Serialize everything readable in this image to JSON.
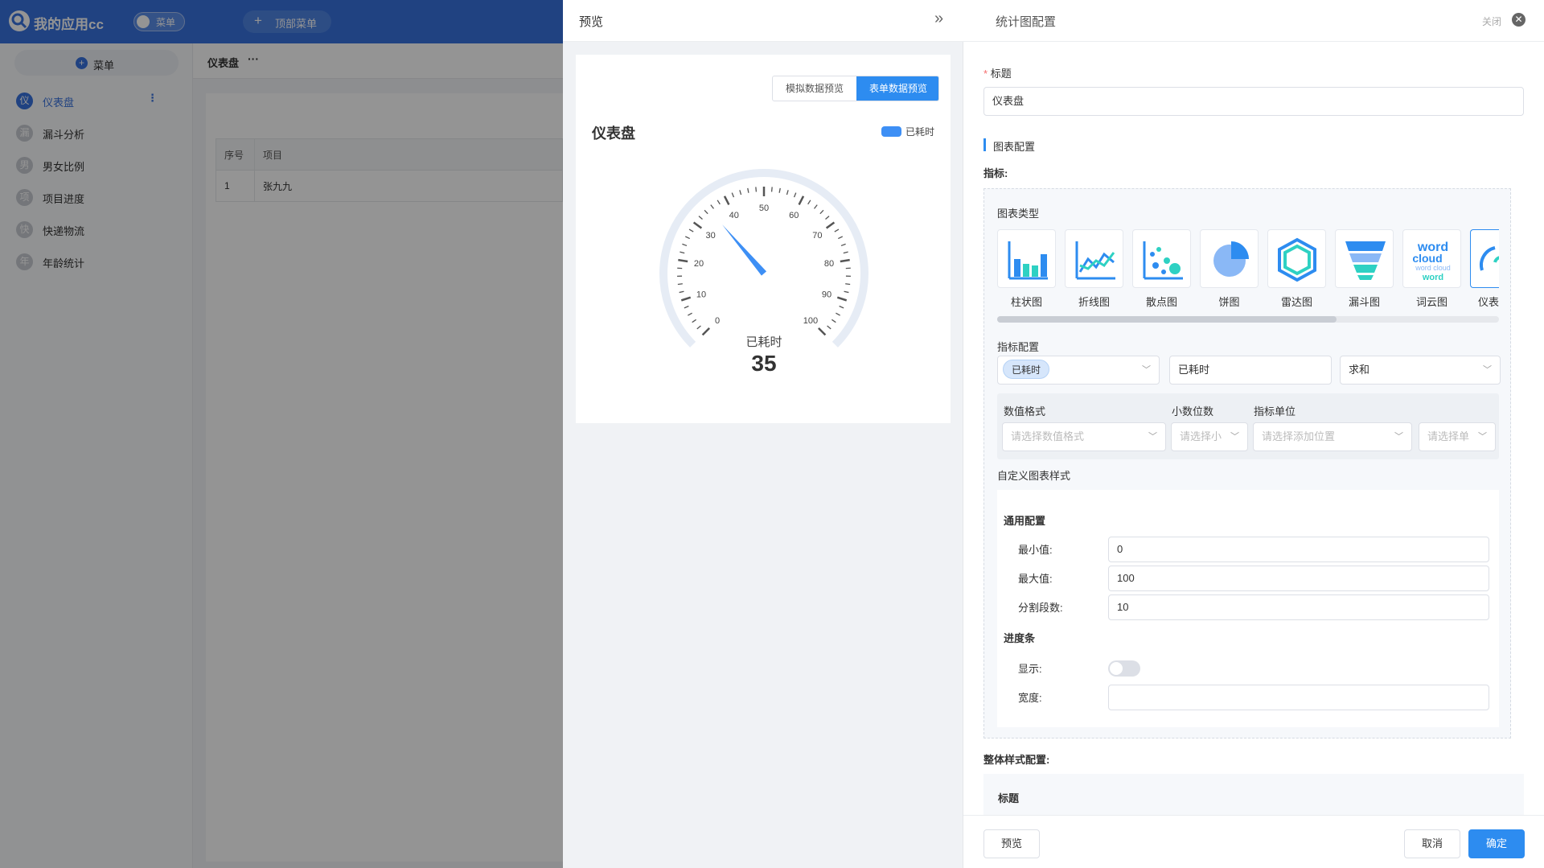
{
  "app": {
    "name": "我的应用cc",
    "menu_toggle_label": "菜单",
    "top_menu_label": "顶部菜单",
    "side_menu_button": "菜单",
    "nav": [
      {
        "icon_char": "仪",
        "label": "仪表盘"
      },
      {
        "icon_char": "漏",
        "label": "漏斗分析"
      },
      {
        "icon_char": "男",
        "label": "男女比例"
      },
      {
        "icon_char": "项",
        "label": "项目进度"
      },
      {
        "icon_char": "快",
        "label": "快递物流"
      },
      {
        "icon_char": "年",
        "label": "年龄统计"
      }
    ],
    "content_title": "仪表盘",
    "content_more": "···",
    "table": {
      "headers": [
        "序号",
        "项目"
      ],
      "rows": [
        [
          "1",
          "张九九"
        ]
      ]
    }
  },
  "preview": {
    "title": "预览",
    "collapse_icon": "»",
    "mode_mock": "模拟数据预览",
    "mode_form": "表单数据预览",
    "chart_title": "仪表盘",
    "legend_label": "已耗时"
  },
  "chart_data": {
    "type": "gauge",
    "title": "仪表盘",
    "series": [
      {
        "name": "已耗时",
        "value": 35
      }
    ],
    "min": 0,
    "max": 100,
    "split_number": 10,
    "tick_labels": [
      "0",
      "10",
      "20",
      "30",
      "40",
      "50",
      "60",
      "70",
      "80",
      "90",
      "100"
    ],
    "value_label": "已耗时",
    "value_text": "35",
    "color": "#3d8ff5"
  },
  "config": {
    "title": "统计图配置",
    "close_label": "关闭",
    "title_field_label": "标题",
    "title_required_mark": "*",
    "title_value": "仪表盘",
    "chart_config_section": "图表配置",
    "metrics_label": "指标:",
    "chart_type_label": "图表类型",
    "chart_types": [
      "柱状图",
      "折线图",
      "散点图",
      "饼图",
      "雷达图",
      "漏斗图",
      "词云图",
      "仪表"
    ],
    "metric_config_label": "指标配置",
    "metric_tag": "已耗时",
    "metric_alias": "已耗时",
    "aggregation": "求和",
    "format_label": "数值格式",
    "format_placeholder": "请选择数值格式",
    "decimal_label": "小数位数",
    "decimal_placeholder": "请选择小",
    "unit_label": "指标单位",
    "unit_pos_placeholder": "请选择添加位置",
    "unit_placeholder": "请选择单",
    "custom_style_label": "自定义图表样式",
    "general_label": "通用配置",
    "min_label": "最小值:",
    "min_value": "0",
    "max_label": "最大值:",
    "max_value": "100",
    "split_label": "分割段数:",
    "split_value": "10",
    "progress_label": "进度条",
    "show_label": "显示:",
    "width_label": "宽度:",
    "width_value": "",
    "overall_label": "整体样式配置:",
    "overall_title": "标题",
    "preview_btn": "预览",
    "cancel_btn": "取消",
    "ok_btn": "确定",
    "wordcloud_text": [
      "word",
      "cloud",
      "word cloud",
      "word"
    ]
  },
  "colors": {
    "accent": "#2d8cf0",
    "topbar": "#3873de",
    "gauge": "#3d8ff5"
  }
}
